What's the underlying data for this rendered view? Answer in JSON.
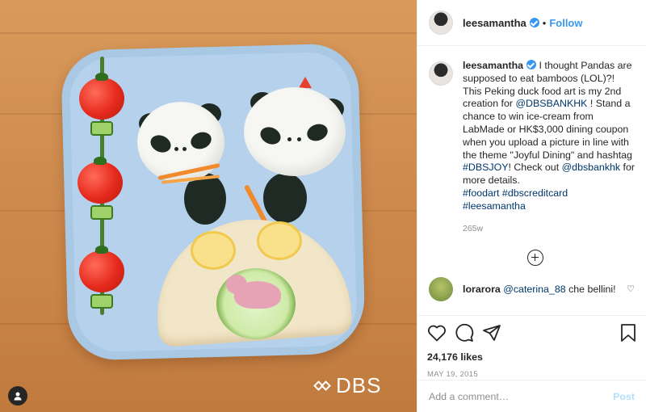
{
  "header": {
    "username": "leesamantha",
    "separator": "•",
    "follow_label": "Follow"
  },
  "caption": {
    "username": "leesamantha",
    "text_1": " I thought Pandas are supposed to eat bamboos (LOL)?! This Peking duck food art is my 2nd creation for ",
    "mention_1": "@DBSBANKHK",
    "text_2": " ! Stand a chance to win ice-cream from LabMade or HK$3,000 dining coupon when you upload a picture in line with the theme \"Joyful Dining\" and hashtag ",
    "hashtag_1": "#DBSJOY",
    "text_3": "! Check out ",
    "mention_2": "@dbsbankhk",
    "text_4": " for more details.",
    "hashtag_2": "#foodart",
    "hashtag_3": "#dbscreditcard",
    "hashtag_4": "#leesamantha",
    "time_ago": "265w"
  },
  "comment": {
    "username": "lorarora",
    "mention": "@caterina_88",
    "text": " che bellini!",
    "heart_icon": "♡"
  },
  "actions": {
    "likes": "24,176 likes",
    "date": "MAY 19, 2015"
  },
  "add_comment": {
    "placeholder": "Add a comment…",
    "post_label": "Post"
  },
  "photo": {
    "brand_logo": "DBS"
  },
  "colors": {
    "accent": "#3897f0",
    "link": "#00376b",
    "muted": "#8e8e8e",
    "post_disabled": "#b2dffc"
  }
}
